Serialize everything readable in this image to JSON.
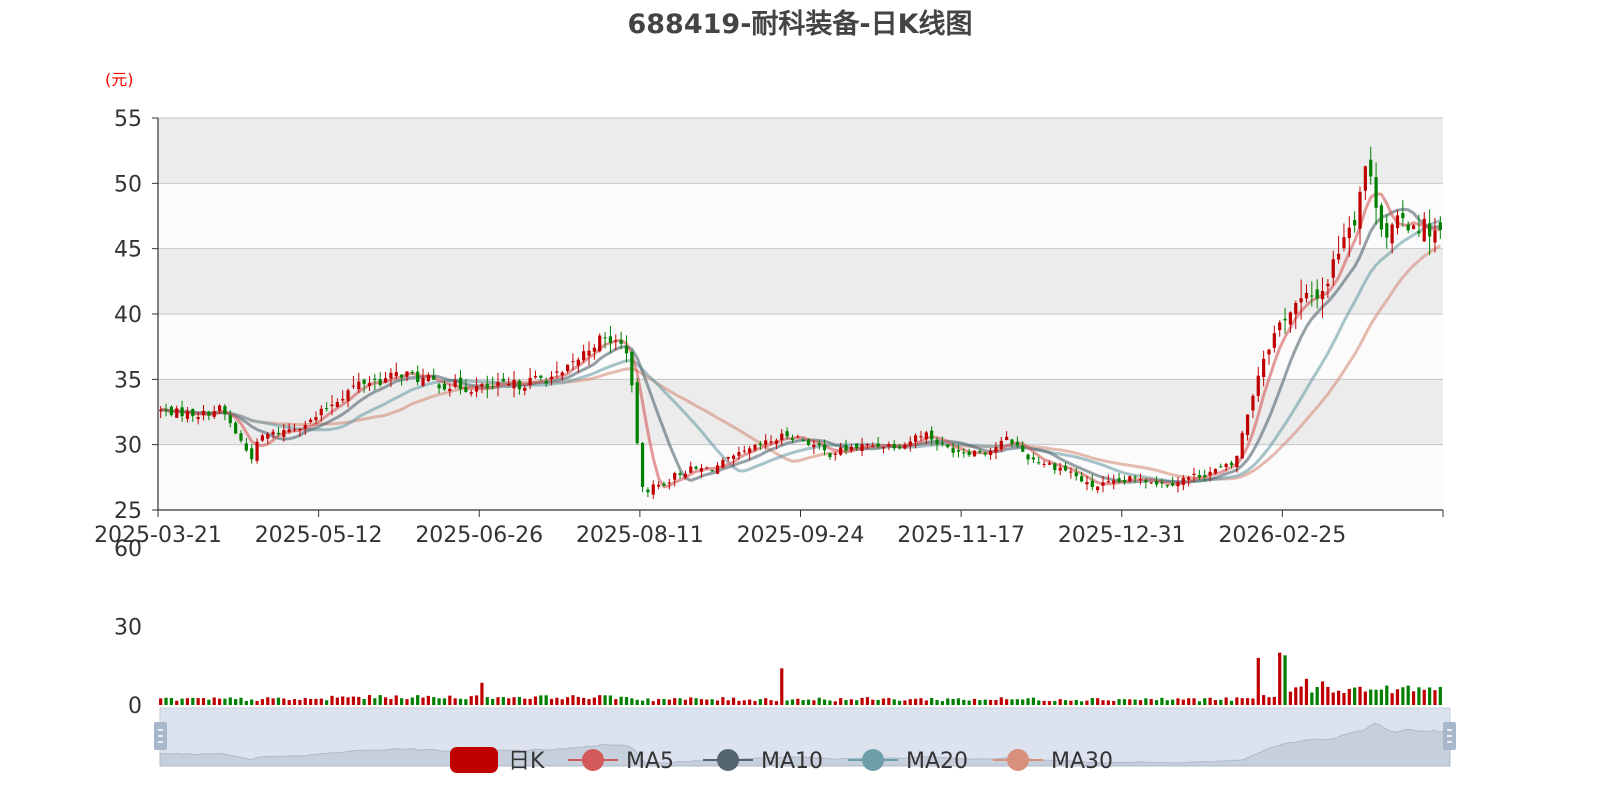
{
  "title": "688419-耐科装备-日K线图",
  "price_unit": "(元)",
  "colors": {
    "up": "#c00000",
    "down": "#008000",
    "ma5": "#d45a5a",
    "ma10": "#546570",
    "ma20": "#6e9ea8",
    "ma30": "#d7907b",
    "band": "#ececec",
    "grid": "#c8c8c8",
    "axis": "#333333",
    "unit_label": "#ff0000",
    "zoom_fill": "#dde3ee",
    "zoom_handle": "#a7b7cc"
  },
  "legend": [
    {
      "label": "日K",
      "icon": "candle-swatch",
      "color": "#c00000"
    },
    {
      "label": "MA5",
      "icon": "line-dot",
      "color": "#d45a5a"
    },
    {
      "label": "MA10",
      "icon": "line-dot",
      "color": "#546570"
    },
    {
      "label": "MA20",
      "icon": "line-dot",
      "color": "#6e9ea8"
    },
    {
      "label": "MA30",
      "icon": "line-dot",
      "color": "#d7907b"
    }
  ],
  "chart_data": {
    "type": "candlestick",
    "title": "688419-耐科装备-日K线图",
    "price_axis": {
      "label": "(元)",
      "ylim": [
        25,
        55
      ],
      "ticks": [
        25,
        30,
        35,
        40,
        45,
        50,
        55
      ],
      "grid": true,
      "banded": true
    },
    "volume_axis": {
      "ylim": [
        0,
        60
      ],
      "ticks": [
        0,
        30,
        60
      ]
    },
    "x_axis": {
      "ticks": [
        "2025-03-21",
        "2025-05-12",
        "2025-06-26",
        "2025-08-11",
        "2025-09-24",
        "2025-11-17",
        "2025-12-31",
        "2026-02-25"
      ]
    },
    "trading_days": 240,
    "close_path_anchors": [
      [
        0,
        32.6
      ],
      [
        8,
        32.3
      ],
      [
        12,
        32.8
      ],
      [
        14,
        31.5
      ],
      [
        18,
        29.0
      ],
      [
        20,
        30.6
      ],
      [
        24,
        31.0
      ],
      [
        30,
        31.8
      ],
      [
        35,
        33.5
      ],
      [
        40,
        34.8
      ],
      [
        45,
        35.0
      ],
      [
        48,
        35.5
      ],
      [
        52,
        35.0
      ],
      [
        58,
        34.5
      ],
      [
        64,
        34.3
      ],
      [
        70,
        34.5
      ],
      [
        75,
        35.0
      ],
      [
        80,
        35.3
      ],
      [
        83,
        36.5
      ],
      [
        87,
        38.0
      ],
      [
        90,
        38.0
      ],
      [
        93,
        37.3
      ],
      [
        96,
        26.5
      ],
      [
        100,
        27.0
      ],
      [
        104,
        28.0
      ],
      [
        110,
        28.2
      ],
      [
        116,
        29.3
      ],
      [
        120,
        30.0
      ],
      [
        125,
        30.8
      ],
      [
        129,
        30.2
      ],
      [
        133,
        29.3
      ],
      [
        138,
        29.8
      ],
      [
        143,
        30.0
      ],
      [
        148,
        30.0
      ],
      [
        152,
        31.0
      ],
      [
        156,
        29.8
      ],
      [
        160,
        29.5
      ],
      [
        165,
        29.5
      ],
      [
        169,
        30.5
      ],
      [
        173,
        29.0
      ],
      [
        177,
        28.5
      ],
      [
        181,
        28.0
      ],
      [
        185,
        26.8
      ],
      [
        190,
        27.0
      ],
      [
        195,
        27.5
      ],
      [
        200,
        27.0
      ],
      [
        205,
        27.5
      ],
      [
        210,
        28.0
      ],
      [
        214,
        28.5
      ],
      [
        218,
        34.5
      ],
      [
        220,
        37.0
      ],
      [
        222,
        38.5
      ],
      [
        224,
        40.0
      ],
      [
        228,
        41.0
      ],
      [
        232,
        42.0
      ],
      [
        236,
        46.5
      ],
      [
        238,
        47.5
      ],
      [
        240,
        51.5
      ],
      [
        242,
        49.0
      ],
      [
        244,
        46.0
      ],
      [
        247,
        47.0
      ],
      [
        250,
        47.0
      ],
      [
        253,
        46.5
      ],
      [
        255,
        46.0
      ]
    ],
    "volume_spikes": [
      [
        64,
        8.5
      ],
      [
        124,
        14.0
      ],
      [
        219,
        18.0
      ],
      [
        223,
        20.0
      ],
      [
        224,
        19.0
      ],
      [
        228,
        10.0
      ],
      [
        232,
        9.0
      ]
    ],
    "series": [
      {
        "name": "日K",
        "type": "candlestick"
      },
      {
        "name": "MA5",
        "type": "line"
      },
      {
        "name": "MA10",
        "type": "line"
      },
      {
        "name": "MA20",
        "type": "line"
      },
      {
        "name": "MA30",
        "type": "line"
      }
    ]
  }
}
